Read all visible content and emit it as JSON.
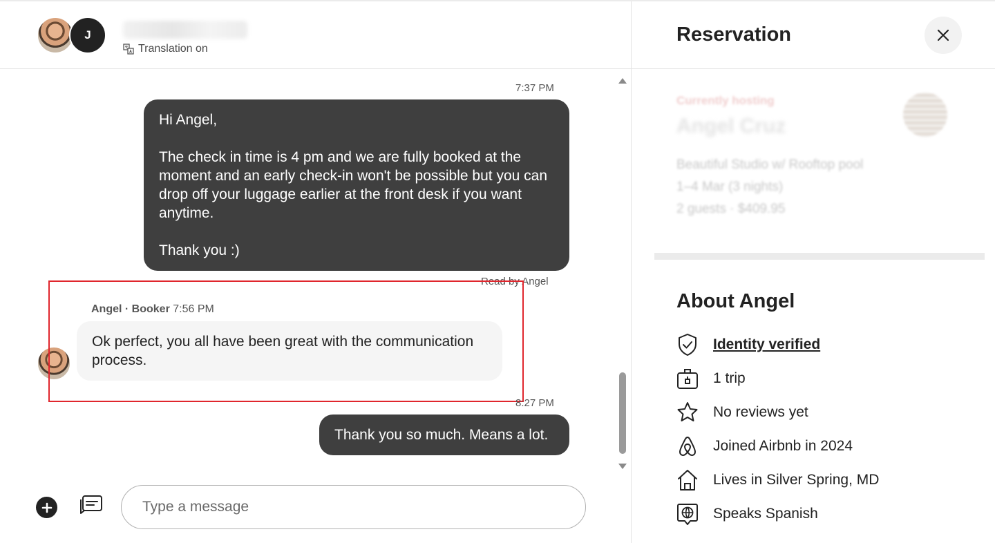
{
  "chat": {
    "header": {
      "avatar_initial": "J",
      "translation_label": "Translation on"
    },
    "messages": [
      {
        "direction": "outgoing",
        "time": "7:37 PM",
        "text": "Hi Angel,\n\nThe check in time is 4 pm and we are fully booked at the moment and an early check-in won't be possible but you can drop off your luggage earlier at the front desk if you want anytime.\n\nThank you :)",
        "receipt": "Read by Angel"
      },
      {
        "direction": "incoming",
        "sender": "Angel · Booker",
        "time": "7:56 PM",
        "text": "Ok perfect, you all have been great with the communication process."
      },
      {
        "direction": "outgoing",
        "time": "8:27 PM",
        "text": "Thank you so much. Means a lot."
      }
    ],
    "composer": {
      "placeholder": "Type a message"
    }
  },
  "panel": {
    "title": "Reservation",
    "card": {
      "status": "Currently hosting",
      "guest_name": "Angel Cruz",
      "listing": "Beautiful Studio w/ Rooftop pool",
      "dates": "1–4 Mar (3 nights)",
      "guests_price": "2 guests · $409.95"
    },
    "about_title": "About Angel",
    "facts": [
      {
        "icon": "shield-check-icon",
        "label": "Identity verified"
      },
      {
        "icon": "suitcase-icon",
        "label": "1 trip"
      },
      {
        "icon": "star-icon",
        "label": "No reviews yet"
      },
      {
        "icon": "airbnb-logo-icon",
        "label": "Joined Airbnb in 2024"
      },
      {
        "icon": "home-icon",
        "label": "Lives in Silver Spring, MD"
      },
      {
        "icon": "globe-chat-icon",
        "label": "Speaks Spanish"
      }
    ]
  },
  "colors": {
    "outgoing_bubble": "#3f3f3f",
    "incoming_bubble": "#f5f5f5",
    "highlight": "#e0262d"
  }
}
